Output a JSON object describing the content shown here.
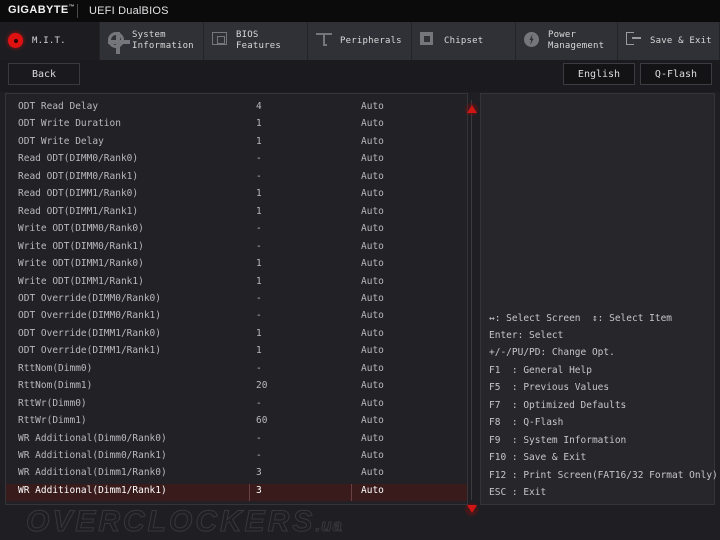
{
  "header": {
    "brand": "GIGABYTE",
    "brand_tm": "™",
    "subtitle": "UEFI DualBIOS"
  },
  "tabs": [
    {
      "label": "M.I.T.",
      "icon": "target-icon",
      "active": true
    },
    {
      "label": "System\nInformation",
      "icon": "gear-icon",
      "active": false
    },
    {
      "label": "BIOS\nFeatures",
      "icon": "chip-icon",
      "active": false
    },
    {
      "label": "Peripherals",
      "icon": "peripheral-icon",
      "active": false
    },
    {
      "label": "Chipset",
      "icon": "cpu-icon",
      "active": false
    },
    {
      "label": "Power\nManagement",
      "icon": "power-icon",
      "active": false
    },
    {
      "label": "Save & Exit",
      "icon": "exit-icon",
      "active": false
    }
  ],
  "toolbar": {
    "back": "Back",
    "language": "English",
    "qflash": "Q-Flash"
  },
  "settings": [
    {
      "name": "ODT Read Delay",
      "value": "4",
      "option": "Auto",
      "selected": false
    },
    {
      "name": "ODT Write Duration",
      "value": "1",
      "option": "Auto",
      "selected": false
    },
    {
      "name": "ODT Write Delay",
      "value": "1",
      "option": "Auto",
      "selected": false
    },
    {
      "name": "Read ODT(DIMM0/Rank0)",
      "value": "-",
      "option": "Auto",
      "selected": false
    },
    {
      "name": "Read ODT(DIMM0/Rank1)",
      "value": "-",
      "option": "Auto",
      "selected": false
    },
    {
      "name": "Read ODT(DIMM1/Rank0)",
      "value": "1",
      "option": "Auto",
      "selected": false
    },
    {
      "name": "Read ODT(DIMM1/Rank1)",
      "value": "1",
      "option": "Auto",
      "selected": false
    },
    {
      "name": "Write ODT(DIMM0/Rank0)",
      "value": "-",
      "option": "Auto",
      "selected": false
    },
    {
      "name": "Write ODT(DIMM0/Rank1)",
      "value": "-",
      "option": "Auto",
      "selected": false
    },
    {
      "name": "Write ODT(DIMM1/Rank0)",
      "value": "1",
      "option": "Auto",
      "selected": false
    },
    {
      "name": "Write ODT(DIMM1/Rank1)",
      "value": "1",
      "option": "Auto",
      "selected": false
    },
    {
      "name": "ODT Override(DIMM0/Rank0)",
      "value": "-",
      "option": "Auto",
      "selected": false
    },
    {
      "name": "ODT Override(DIMM0/Rank1)",
      "value": "-",
      "option": "Auto",
      "selected": false
    },
    {
      "name": "ODT Override(DIMM1/Rank0)",
      "value": "1",
      "option": "Auto",
      "selected": false
    },
    {
      "name": "ODT Override(DIMM1/Rank1)",
      "value": "1",
      "option": "Auto",
      "selected": false
    },
    {
      "name": "RttNom(Dimm0)",
      "value": "-",
      "option": "Auto",
      "selected": false
    },
    {
      "name": "RttNom(Dimm1)",
      "value": "20",
      "option": "Auto",
      "selected": false
    },
    {
      "name": "RttWr(Dimm0)",
      "value": "-",
      "option": "Auto",
      "selected": false
    },
    {
      "name": "RttWr(Dimm1)",
      "value": "60",
      "option": "Auto",
      "selected": false
    },
    {
      "name": "WR Additional(Dimm0/Rank0)",
      "value": "-",
      "option": "Auto",
      "selected": false
    },
    {
      "name": "WR Additional(Dimm0/Rank1)",
      "value": "-",
      "option": "Auto",
      "selected": false
    },
    {
      "name": "WR Additional(Dimm1/Rank0)",
      "value": "3",
      "option": "Auto",
      "selected": false
    },
    {
      "name": "WR Additional(Dimm1/Rank1)",
      "value": "3",
      "option": "Auto",
      "selected": true
    }
  ],
  "scroll": {
    "up_indicator": "scroll-up-triangle",
    "down_indicator": "scroll-down-triangle"
  },
  "help": [
    "↔: Select Screen  ↕: Select Item",
    "Enter: Select",
    "+/-/PU/PD: Change Opt.",
    "F1  : General Help",
    "F5  : Previous Values",
    "F7  : Optimized Defaults",
    "F8  : Q-Flash",
    "F9  : System Information",
    "F10 : Save & Exit",
    "F12 : Print Screen(FAT16/32 Format Only)",
    "ESC : Exit"
  ],
  "watermark": {
    "main": "OVERCLOCKERS",
    "suffix": ".ua"
  },
  "colors": {
    "accent_red": "#d01515",
    "selection_bg": "#3a1b1b",
    "panel_bg": "#222226",
    "tabbar_bg": "#303136"
  }
}
